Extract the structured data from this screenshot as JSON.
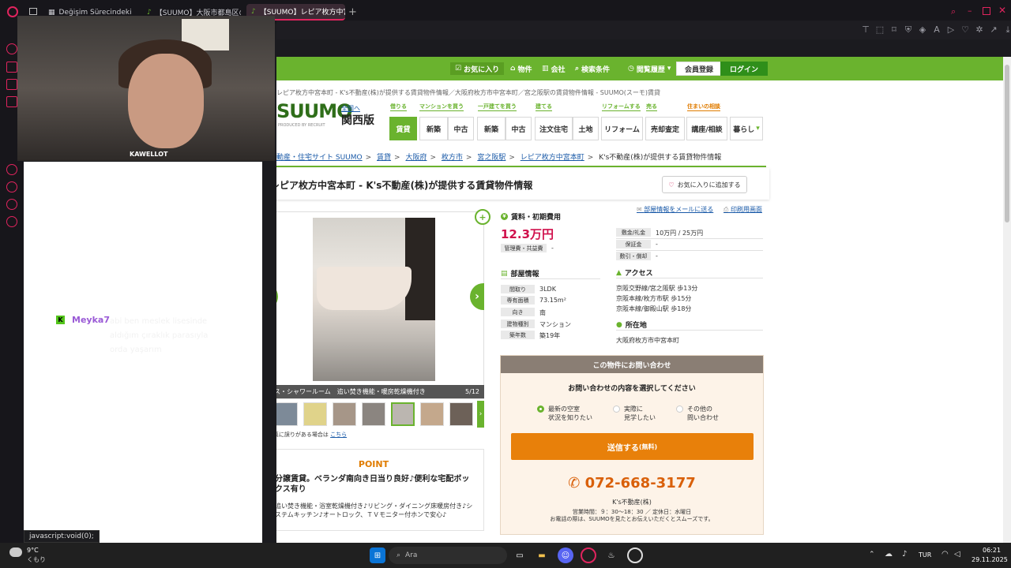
{
  "browser": {
    "tabs": [
      {
        "label": "Değişim Sürecindeki Ca..."
      },
      {
        "label": "【SUUMO】大阪市都島区の..."
      },
      {
        "label": "【SUUMO】レピア枚方中宮本町"
      }
    ]
  },
  "overlay": {
    "cam_label": "KAWELLOT",
    "chat": {
      "user": "Meyka7",
      "message": "abi ben meslek lisesinde aldığım çıraklık parasıyla orda yaşarım"
    },
    "status_url": "javascript:void(0);"
  },
  "site": {
    "topnav": {
      "favorites": "お気に入り",
      "properties": "物件",
      "companies": "会社",
      "search_conditions": "検索条件",
      "history": "閲覧履歴",
      "register": "会員登録",
      "login": "ログイン"
    },
    "top_breadcrumb": "レピア枚方中宮本町 - K's不動産(株)が提供する賃貸物件情報／大阪府枚方市中宮本町／宮之阪駅の賃貸物件情報 - SUUMO(スーモ)賃貸",
    "logo": "SUUMO",
    "logo_sub": "PRODUCED BY RECRUIT",
    "region_link": "全国へ",
    "region": "関西版",
    "categories": {
      "rent": "借りる",
      "buy_mansion": "マンションを買う",
      "buy_house": "一戸建てを買う",
      "build": "建てる",
      "reform": "リフォームする",
      "sell": "売る",
      "advice": "住まいの相談"
    },
    "nav_buttons": [
      "賃貸",
      "新築",
      "中古",
      "新築",
      "中古",
      "注文住宅",
      "土地",
      "リフォーム",
      "売却査定",
      "講座/相談",
      "暮らし"
    ],
    "breadcrumb": [
      "動産・住宅サイト SUUMO",
      "賃貸",
      "大阪府",
      "枚方市",
      "宮之阪駅",
      "レピア枚方中宮本町",
      "K's不動産(株)が提供する賃貸物件情報"
    ],
    "title": "レピア枚方中宮本町 - K's不動産(株)が提供する賃貸物件情報",
    "fav_button": "お気に入りに追加する",
    "gallery": {
      "caption": "バス・シャワールーム　追い焚き機能・暖房乾燥機付き",
      "counter": "5/12",
      "note": "※写真に誤りがある場合は",
      "note_link": "こちら"
    },
    "point": {
      "heading": "POINT",
      "title": "分譲賃貸。ベランダ南向き日当り良好♪便利な宅配ボックス有り",
      "desc": "追い焚き機能・浴室乾燥機付き♪リビング・ダイニング床暖房付き♪システムキッチン♪オートロック、ＴＶモニター付ホンで安心♪"
    },
    "links": {
      "email": "部屋情報をメールに送る",
      "print": "印刷用画面"
    },
    "fees": {
      "heading": "賃料・初期費用",
      "rent": "12.3万円",
      "mgmt_label": "管理費・共益費",
      "mgmt_value": "-",
      "deposit_label": "敷金/礼金",
      "deposit_value": "10万円 / 25万円",
      "guarantee_label": "保証金",
      "guarantee_value": "-",
      "shikibiki_label": "敷引・償却",
      "shikibiki_value": "-"
    },
    "room": {
      "heading": "部屋情報",
      "layout_label": "間取り",
      "layout_value": "3LDK",
      "area_label": "専有面積",
      "area_value": "73.15m²",
      "direction_label": "向き",
      "direction_value": "南",
      "type_label": "建物種別",
      "type_value": "マンション",
      "age_label": "築年数",
      "age_value": "築19年"
    },
    "access": {
      "heading": "アクセス",
      "lines": [
        "京阪交野線/宮之阪駅 歩13分",
        "京阪本線/枚方市駅 歩15分",
        "京阪本線/御殿山駅 歩18分"
      ]
    },
    "address": {
      "heading": "所在地",
      "value": "大阪府枚方市中宮本町"
    },
    "contact": {
      "header": "この物件にお問い合わせ",
      "question": "お問い合わせの内容を選択してください",
      "options": [
        {
          "line1": "最新の空室",
          "line2": "状況を知りたい"
        },
        {
          "line1": "実際に",
          "line2": "見学したい"
        },
        {
          "line1": "その他の",
          "line2": "問い合わせ"
        }
      ],
      "send": "送信する",
      "send_note": "(無料)",
      "tel": "072-668-3177",
      "company": "K's不動産(株)",
      "hours": "営業時間：９：30〜18：30 ／ 定休日：水曜日",
      "hours2": "お電話の際は、SUUMOを見たとお伝えいただくとスムーズです。"
    }
  },
  "taskbar": {
    "weather_temp": "9°C",
    "weather_desc": "くもり",
    "search_placeholder": "Ara",
    "lang": "TUR",
    "time": "06:21",
    "date": "29.11.2025"
  }
}
